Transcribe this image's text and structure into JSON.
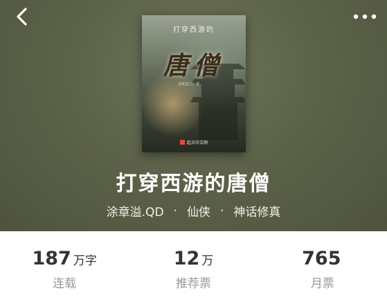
{
  "header": {
    "back_icon": "chevron-left-icon",
    "more_icon": "more-horizontal-icon"
  },
  "cover": {
    "series_text": "打穿西游的",
    "title_text": "唐僧",
    "author_text": "涂章溢.QD 著",
    "publisher_text": "起点中文网"
  },
  "book": {
    "title": "打穿西游的唐僧",
    "author": "涂章溢.QD",
    "separator": "·",
    "category": "仙侠",
    "subcategory": "神话修真"
  },
  "stats": [
    {
      "value": "187",
      "unit": "万字",
      "label": "连载"
    },
    {
      "value": "12",
      "unit": "万",
      "label": "推荐票"
    },
    {
      "value": "765",
      "unit": "",
      "label": "月票"
    }
  ],
  "colors": {
    "hero_bg": "#5d634a",
    "title_text": "#ffffff",
    "stat_number": "#333333",
    "stat_label": "#999999"
  }
}
